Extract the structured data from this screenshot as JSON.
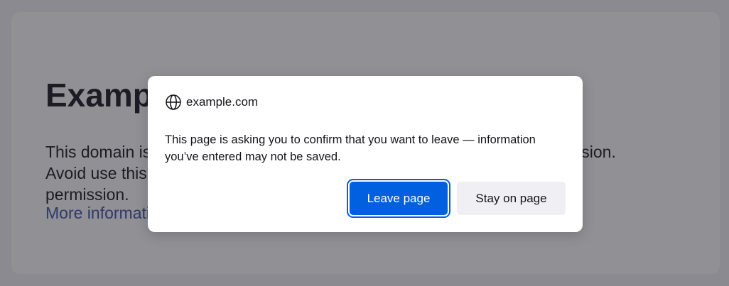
{
  "page": {
    "heading": "Example Domain",
    "paragraph": "This domain is for use in documentation examples without needing permission. Avoid use this domain in literature without prior coordination or asking for permission.",
    "link_text": "More information..."
  },
  "dialog": {
    "icon": "globe-icon",
    "origin": "example.com",
    "message": "This page is asking you to confirm that you want to leave — information you’ve entered may not be saved.",
    "primary_button": "Leave page",
    "secondary_button": "Stay on page"
  },
  "colors": {
    "primary": "#0060df",
    "link": "#3b4fa8",
    "backdrop": "rgba(38,36,46,0.5)"
  }
}
